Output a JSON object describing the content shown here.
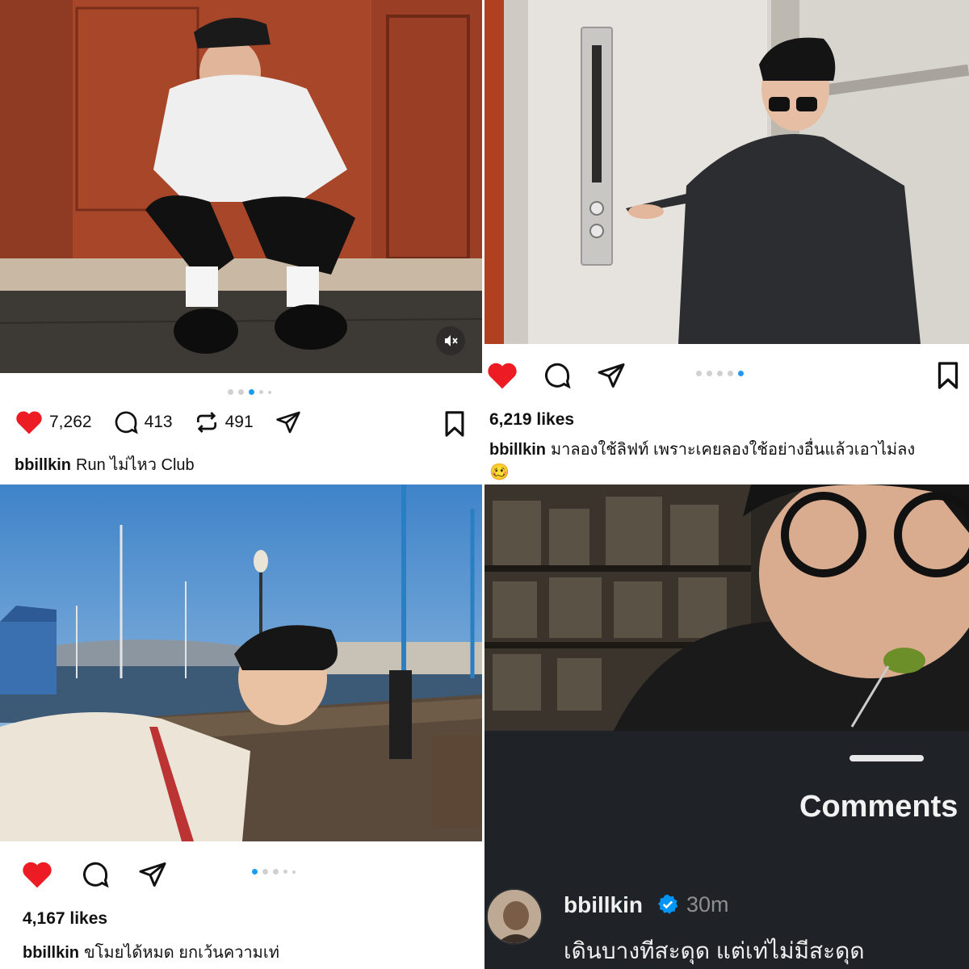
{
  "posts": [
    {
      "username": "bbillkin",
      "caption": "Run ไม่ไหว Club",
      "like_count": "7,262",
      "comment_count": "413",
      "repost_count": "491",
      "carousel": {
        "total": 6,
        "active_index": 2
      }
    },
    {
      "username": "bbillkin",
      "likes_label": "6,219 likes",
      "caption": "มาลองใช้ลิฟท์ เพราะเคยลองใช้อย่างอื่นแล้วเอาไม่ลง",
      "caption_emoji": "🥴",
      "carousel": {
        "total": 5,
        "active_index": 4
      }
    },
    {
      "username": "bbillkin",
      "likes_label": "4,167 likes",
      "caption": "ขโมยได้หมด ยกเว้นความเท่",
      "carousel": {
        "total": 5,
        "active_index": 0
      }
    }
  ],
  "comments_sheet": {
    "title": "Comments",
    "comment": {
      "username": "bbillkin",
      "verified": true,
      "time": "30m",
      "text": "เดินบางทีสะดุด แต่เท่ไม่มีสะดุด"
    }
  },
  "colors": {
    "like_red": "#ed1c24",
    "carousel_active": "#1d9bf0",
    "verified_blue": "#0095f6"
  },
  "icons": [
    "heart-icon",
    "comment-icon",
    "repost-icon",
    "share-icon",
    "bookmark-icon",
    "mute-icon",
    "verified-icon"
  ]
}
